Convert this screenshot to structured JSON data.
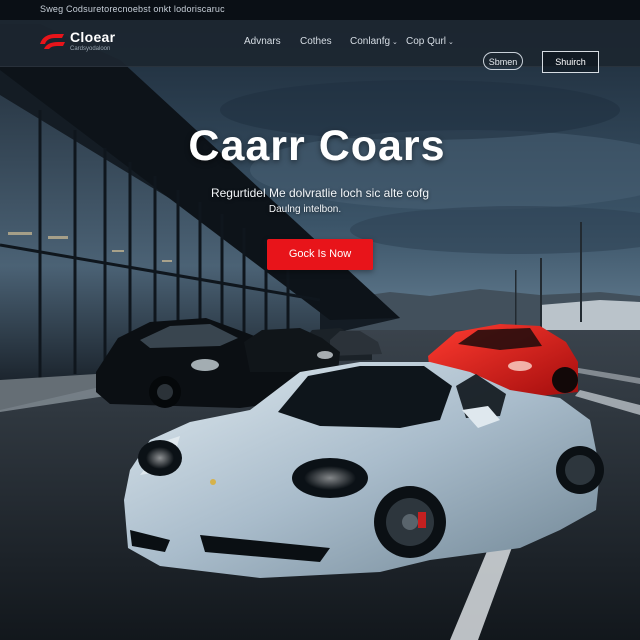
{
  "topbar": {
    "text": "Sweg Codsuretorecnoebst onkt lodoriscaruc"
  },
  "brand": {
    "name": "Cloear",
    "tagline": "Cardsyodaloon",
    "accent": "#e8141a"
  },
  "nav": {
    "links": [
      {
        "label": "Advnars"
      },
      {
        "label": "Cothes"
      },
      {
        "label": "Conlanfg",
        "has_dropdown": true
      },
      {
        "label": "Cop Qurl",
        "has_dropdown": true
      }
    ],
    "outline_button_label": "Sbmen",
    "box_button_label": "Shuirch"
  },
  "hero": {
    "title": "Caarr Coars",
    "subtitle_line1": "Regurtidel Me dolvratlie loch sic alte cofg",
    "subtitle_line2": "Daulng intelbon.",
    "cta_label": "Gock Is Now",
    "cta_color": "#e8141a"
  },
  "colors": {
    "sky_top": "#243447",
    "sky_horizon": "#a7b8c7",
    "road": "#1d2329",
    "featured_car": "#b9c9d4",
    "red_car": "#d81c1c"
  }
}
